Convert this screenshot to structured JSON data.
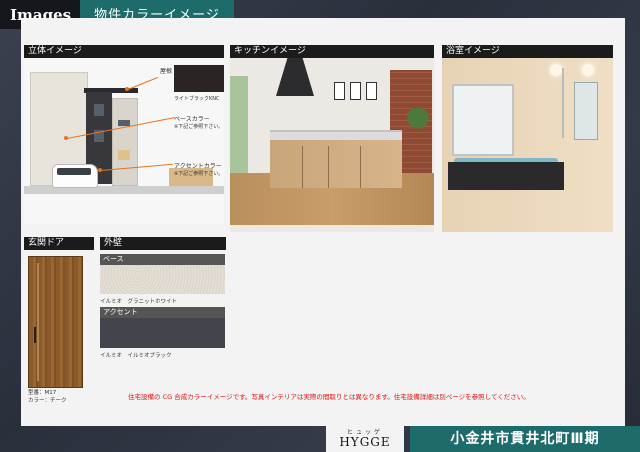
{
  "header": {
    "images_label": "Images",
    "section_title": "物件カラーイメージ"
  },
  "exterior": {
    "label": "立体イメージ",
    "callouts": {
      "roof": "屋根",
      "roof_color": "ライトブラックKNC",
      "base": "ベースカラー",
      "base_note": "※下記ご参照下さい。",
      "accent": "アクセントカラー",
      "accent_note": "※下記ご参照下さい。"
    }
  },
  "kitchen": {
    "label": "キッチンイメージ"
  },
  "bath": {
    "label": "浴室イメージ"
  },
  "door": {
    "label": "玄関ドア",
    "model": "型番：M17",
    "color": "カラー：チーク"
  },
  "wall": {
    "label": "外壁",
    "base_label": "ベース",
    "base_caption": "イルミオ　グラニットホワイト",
    "accent_label": "アクセント",
    "accent_caption": "イルミオ　イルミオブラック"
  },
  "note": "住宅設備の CG 合成カラーイメージです。写真インテリアは実際の間取りとは異なります。住宅設備詳細は別ページを参照してください。",
  "brand": {
    "ruby": "ヒュッゲ",
    "name": "HYGGE"
  },
  "project_title": "小金井市貫井北町Ⅲ期",
  "colors": {
    "teal": "#1d6b6b",
    "accent_orange": "#e8731e",
    "note_red": "#dd1111"
  }
}
